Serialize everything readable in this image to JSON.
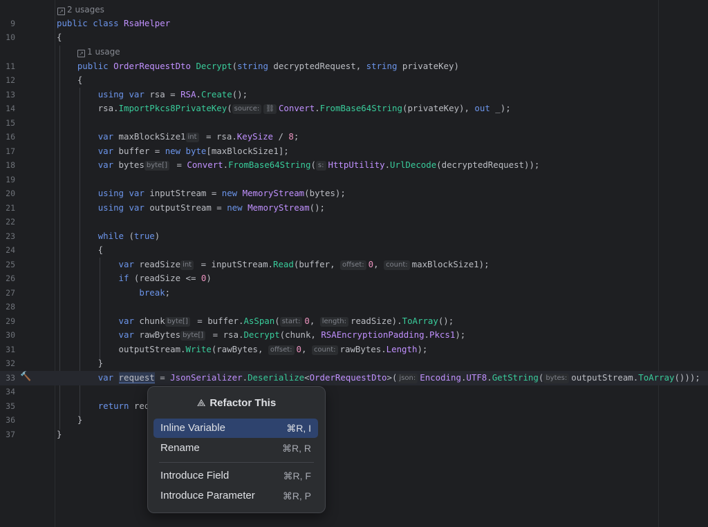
{
  "editor": {
    "usages": {
      "class": "2 usages",
      "method": "1 usage"
    },
    "lines": {
      "l9": "9",
      "l10": "10",
      "l11": "11",
      "l12": "12",
      "l13": "13",
      "l14": "14",
      "l15": "15",
      "l16": "16",
      "l17": "17",
      "l18": "18",
      "l19": "19",
      "l20": "20",
      "l21": "21",
      "l22": "22",
      "l23": "23",
      "l24": "24",
      "l25": "25",
      "l26": "26",
      "l27": "27",
      "l28": "28",
      "l29": "29",
      "l30": "30",
      "l31": "31",
      "l32": "32",
      "l33": "33",
      "l34": "34",
      "l35": "35",
      "l36": "36",
      "l37": "37"
    },
    "hints": {
      "source": "source:",
      "int": "int",
      "byte_arr": "byte[]",
      "s": "s:",
      "offset": "offset:",
      "count": "count:",
      "start": "start:",
      "length": "length:",
      "json": "json:",
      "bytes": "bytes:"
    }
  },
  "popup": {
    "title": "Refactor This",
    "items": [
      {
        "label": "Inline Variable",
        "shortcut": "⌘R, I"
      },
      {
        "label": "Rename",
        "shortcut": "⌘R, R"
      },
      {
        "label": "Introduce Field",
        "shortcut": "⌘R, F"
      },
      {
        "label": "Introduce Parameter",
        "shortcut": "⌘R, P"
      }
    ]
  }
}
